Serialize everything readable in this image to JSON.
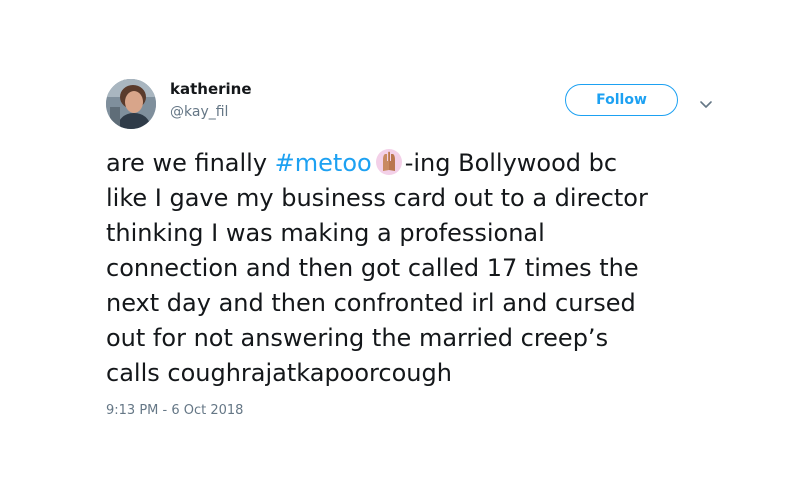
{
  "user": {
    "display_name": "katherine",
    "handle": "@kay_fil"
  },
  "actions": {
    "follow_label": "Follow",
    "menu_icon": "chevron-down-icon"
  },
  "tweet": {
    "line1_prefix": "are we finally ",
    "hashtag": "#metoo",
    "emoji_icon": "raising-hands-icon",
    "line1_suffix": "-ing Bollywood bc",
    "line2": "like I gave my business card out to a director",
    "line3": "thinking I was making a professional",
    "line4": "connection and then got called 17 times the",
    "line5": "next day and then confronted irl and cursed",
    "line6": "out for not answering the married creep’s",
    "line7": "calls coughrajatkapoorcough"
  },
  "timestamp": "9:13 PM - 6 Oct 2018",
  "colors": {
    "accent": "#1da1f2",
    "text": "#14171a",
    "muted": "#657786"
  }
}
